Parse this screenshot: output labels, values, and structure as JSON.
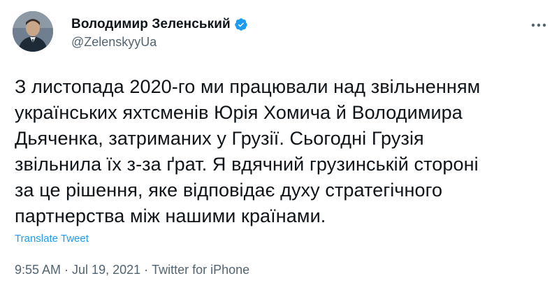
{
  "author": {
    "name": "Володимир Зеленський",
    "handle": "@ZelenskyyUa",
    "verified": true
  },
  "tweet": {
    "text": "З листопада 2020-го ми працювали над звільненням\nукраїнських яхтсменів Юрія Хомича й Володимира\nДьяченка, затриманих у Грузії. Сьогодні Грузія\nзвільнила їх з-за ґрат. Я вдячний грузинській стороні\nза це рішення, яке відповідає духу стратегічного\nпартнерства між нашими країнами.",
    "translate_label": "Translate Tweet",
    "time": "9:55 AM",
    "date": "Jul 19, 2021",
    "separator": "·",
    "source": "Twitter for iPhone"
  },
  "icons": {
    "verified": "verified-badge-icon",
    "more": "more-options-icon"
  },
  "colors": {
    "link": "#1d9bf0",
    "secondary": "#536471",
    "text": "#0f1419"
  }
}
